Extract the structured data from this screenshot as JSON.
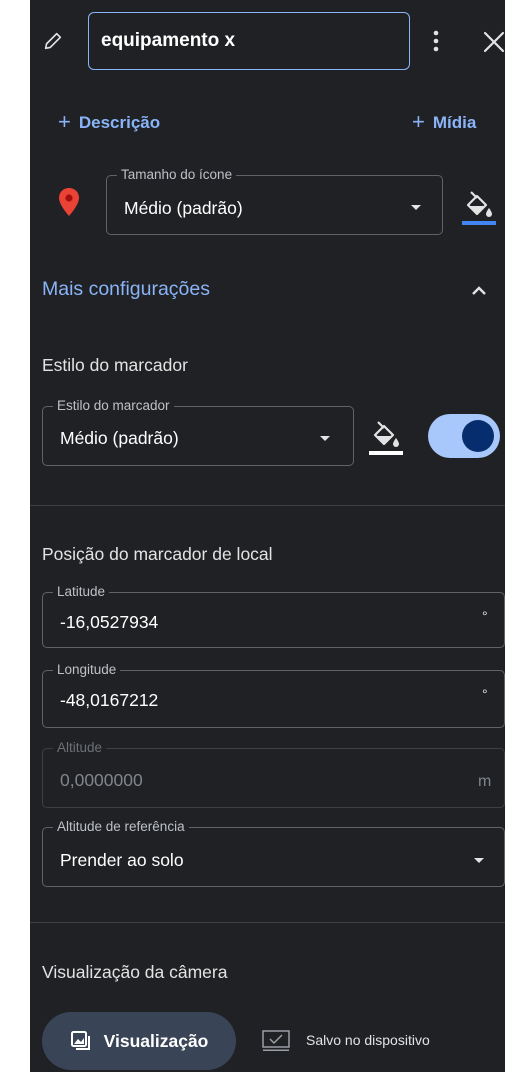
{
  "header": {
    "name_value": "equipamento x"
  },
  "actions": {
    "add_description": "Descrição",
    "add_media": "Mídia",
    "plus_glyph": "+"
  },
  "icon_size": {
    "label": "Tamanho do ícone",
    "value": "Médio (padrão)",
    "marker_color": "#ea4335",
    "fill_underline_color": "#4285f4"
  },
  "more_settings": {
    "label": "Mais configurações",
    "expanded": true
  },
  "marker_style": {
    "section_title": "Estilo do marcador",
    "field_label": "Estilo do marcador",
    "value": "Médio (padrão)",
    "fill_underline_color": "#ffffff",
    "toggle_on": true
  },
  "position": {
    "section_title": "Posição do marcador de local",
    "latitude": {
      "label": "Latitude",
      "value": "-16,0527934",
      "unit": "°"
    },
    "longitude": {
      "label": "Longitude",
      "value": "-48,0167212",
      "unit": "°"
    },
    "altitude": {
      "label": "Altitude",
      "value": "0,0000000",
      "unit": "m",
      "disabled": true
    },
    "altitude_ref": {
      "label": "Altitude de referência",
      "value": "Prender ao solo"
    }
  },
  "camera": {
    "section_title": "Visualização da câmera",
    "preview_button": "Visualização",
    "saved_label": "Salvo no dispositivo"
  },
  "colors": {
    "panel_bg": "#202124",
    "accent": "#8ab4f8",
    "toggle_track": "#a8c7fa",
    "toggle_knob": "#062e6f",
    "button_bg": "#394457"
  }
}
